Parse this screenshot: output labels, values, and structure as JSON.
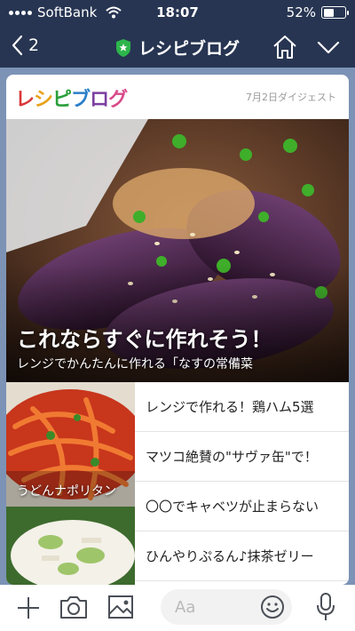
{
  "status": {
    "carrier": "SoftBank",
    "time": "18:07",
    "battery": "52%",
    "battery_level": 0.52
  },
  "nav": {
    "back_count": "2",
    "title": "レシピブログ"
  },
  "card": {
    "logo": "レシピブログ",
    "digest_date": "7月2日ダイジェスト",
    "hero": {
      "title": "これならすぐに作れそう！",
      "subtitle": "レンジでかんたんに作れる「なすの常備菜"
    },
    "thumb_labels": [
      "うどんナポリタン"
    ],
    "items": [
      "レンジで作れる！鶏ハム5選",
      "マツコ絶賛の\"サヴァ缶\"で！",
      "〇〇でキャベツが止まらない",
      "ひんやりぷるん♪抹茶ゼリー"
    ]
  },
  "input": {
    "placeholder": "Aa"
  },
  "colors": {
    "header": "#273552",
    "chat_bg": "#7c93b6",
    "shield_green": "#2db54b"
  }
}
